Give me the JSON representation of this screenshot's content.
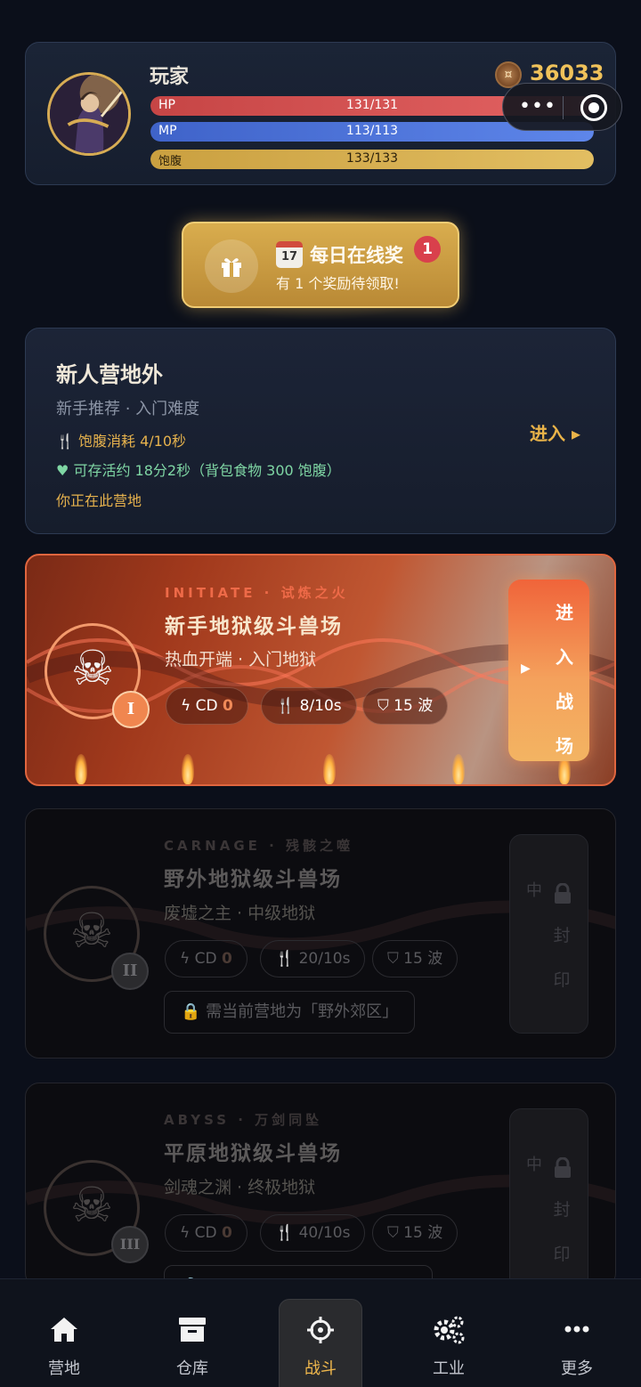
{
  "player": {
    "name": "玩家",
    "coins": "36033",
    "hp": {
      "label": "HP",
      "value": "131/131",
      "fraction": 1.0
    },
    "mp": {
      "label": "MP",
      "value": "113/113",
      "fraction": 1.0
    },
    "food": {
      "label": "饱腹",
      "value": "133/133",
      "fraction": 1.0
    }
  },
  "daily_reward": {
    "calendar_day": "17",
    "title": "每日在线奖",
    "subtitle": "有 1 个奖励待领取!",
    "badge": "1"
  },
  "camp": {
    "title": "新人营地外",
    "subtitle": "新手推荐 · 入门难度",
    "food_cost": "饱腹消耗 4/10秒",
    "survival": "可存活约 18分2秒（背包食物 300 饱腹）",
    "here": "你正在此营地",
    "enter": "进入 ▸"
  },
  "arenas": [
    {
      "tag": "INITIATE · 试炼之火",
      "title": "新手地狱级斗兽场",
      "subtitle": "热血开端 · 入门地狱",
      "roman": "I",
      "cd_label": "CD",
      "cd_value": "0",
      "food": "8/10s",
      "waves": "15 波",
      "enter_arrow": "▶",
      "enter_chars": [
        "进",
        "入",
        "战",
        "场"
      ]
    },
    {
      "tag": "CARNAGE · 残骸之噬",
      "title": "野外地狱级斗兽场",
      "subtitle": "废墟之主 · 中级地狱",
      "roman": "II",
      "cd_label": "CD",
      "cd_value": "0",
      "food": "20/10s",
      "waves": "15 波",
      "requirement": "需当前营地为「野外郊区」",
      "sealed_mid": "中",
      "sealed_chars": [
        "封",
        "印"
      ]
    },
    {
      "tag": "ABYSS · 万剑同坠",
      "title": "平原地狱级斗兽场",
      "subtitle": "剑魂之渊 · 终极地狱",
      "roman": "III",
      "cd_label": "CD",
      "cd_value": "0",
      "food": "40/10s",
      "waves": "15 波",
      "sealed_mid": "中",
      "sealed_chars": [
        "封",
        "印"
      ]
    }
  ],
  "nav": {
    "items": [
      {
        "label": "营地",
        "icon": "home-icon"
      },
      {
        "label": "仓库",
        "icon": "archive-icon"
      },
      {
        "label": "战斗",
        "icon": "crosshair-icon",
        "active": true
      },
      {
        "label": "工业",
        "icon": "gears-icon"
      },
      {
        "label": "更多",
        "icon": "more-dots-icon"
      }
    ]
  },
  "colors": {
    "background": "#0b0f1a",
    "gold": "#f0c25a",
    "hp": "#d64f4f",
    "mp": "#4e74dc",
    "food": "#d8b252",
    "arena_active": "#e0663f",
    "nav_active": "#f0b84c"
  }
}
